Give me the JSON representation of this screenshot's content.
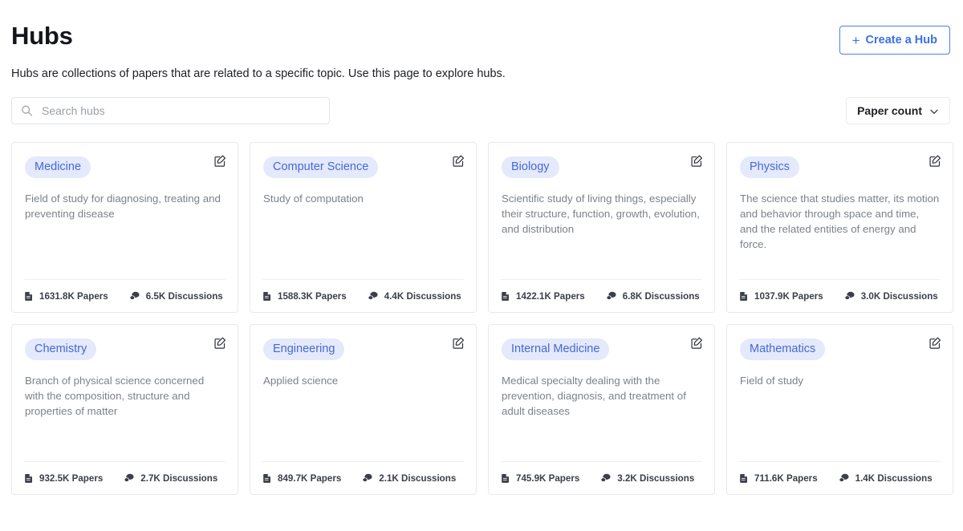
{
  "header": {
    "title": "Hubs",
    "create_button_label": "Create a Hub",
    "create_button_plus": "+",
    "subtitle": "Hubs are collections of papers that are related to a specific topic. Use this page to explore hubs."
  },
  "controls": {
    "search_placeholder": "Search hubs",
    "search_value": "",
    "search_icon": "search-icon",
    "sort_label": "Paper count",
    "sort_icon": "chevron-down-icon"
  },
  "icons": {
    "edit": "edit-icon",
    "papers": "document-icon",
    "discussions": "chat-bubbles-icon"
  },
  "colors": {
    "accent_blue": "#3971e8",
    "tag_bg": "#e4e9fb",
    "tag_text": "#4569d6",
    "card_border": "#e7e9eb",
    "muted_text": "#7c8289"
  },
  "hubs": [
    {
      "name": "Medicine",
      "description": "Field of study for diagnosing, treating and preventing disease",
      "papers": "1631.8K Papers",
      "discussions": "6.5K Discussions"
    },
    {
      "name": "Computer Science",
      "description": "Study of computation",
      "papers": "1588.3K Papers",
      "discussions": "4.4K Discussions"
    },
    {
      "name": "Biology",
      "description": "Scientific study of living things, especially their structure, function, growth, evolution, and distribution",
      "papers": "1422.1K Papers",
      "discussions": "6.8K Discussions"
    },
    {
      "name": "Physics",
      "description": "The science that studies matter, its motion and behavior through space and time, and the related entities of energy and force.",
      "papers": "1037.9K Papers",
      "discussions": "3.0K Discussions"
    },
    {
      "name": "Chemistry",
      "description": "Branch of physical science concerned with the composition, structure and properties of matter",
      "papers": "932.5K Papers",
      "discussions": "2.7K Discussions"
    },
    {
      "name": "Engineering",
      "description": "Applied science",
      "papers": "849.7K Papers",
      "discussions": "2.1K Discussions"
    },
    {
      "name": "Internal Medicine",
      "description": "Medical specialty dealing with the prevention, diagnosis, and treatment of adult diseases",
      "papers": "745.9K Papers",
      "discussions": "3.2K Discussions"
    },
    {
      "name": "Mathematics",
      "description": "Field of study",
      "papers": "711.6K Papers",
      "discussions": "1.4K Discussions"
    }
  ]
}
